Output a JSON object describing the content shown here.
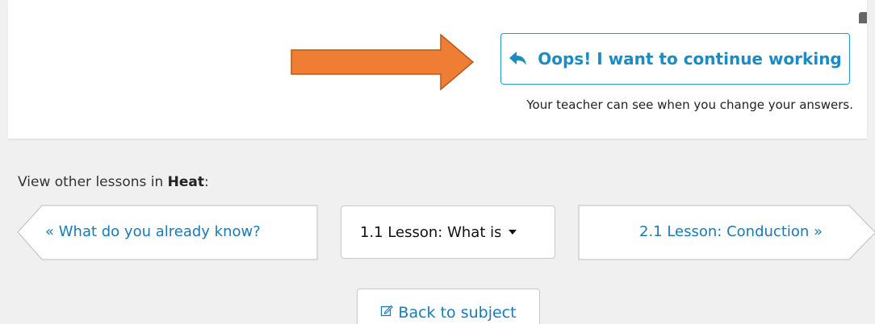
{
  "continue_button": {
    "label": "Oops! I want to continue working",
    "icon": "reply-arrow-icon"
  },
  "teacher_note": "Your teacher can see when you change your answers.",
  "lesson_nav": {
    "view_other_prefix": "View other lessons in ",
    "subject": "Heat",
    "view_other_suffix": ":",
    "previous_label": "«  What do you already know?",
    "current_select_value": "1.1 Lesson: What is",
    "next_label": "2.1 Lesson: Conduction  »"
  },
  "back_button": {
    "label": "Back to subject",
    "icon": "edit-note-icon"
  },
  "colors": {
    "accent": "#1a8cc4",
    "annotation_arrow": "#ef7d33",
    "background": "#f0f0f0"
  }
}
